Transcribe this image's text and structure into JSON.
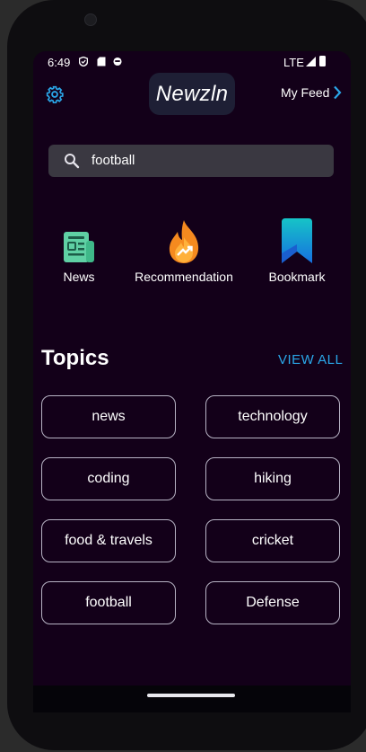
{
  "status_bar": {
    "time": "6:49",
    "network": "LTE"
  },
  "header": {
    "logo": "Newzln",
    "my_feed": "My Feed"
  },
  "search": {
    "value": "football",
    "placeholder": ""
  },
  "quick_actions": [
    {
      "label": "News",
      "icon": "newspaper-icon"
    },
    {
      "label": "Recommendation",
      "icon": "fire-trending-icon"
    },
    {
      "label": "Bookmark",
      "icon": "bookmark-icon"
    }
  ],
  "topics": {
    "title": "Topics",
    "view_all": "VIEW ALL",
    "items": [
      "news",
      "technology",
      "coding",
      "hiking",
      "food & travels",
      "cricket",
      "football",
      "Defense"
    ]
  },
  "colors": {
    "screen_bg": "#130019",
    "accent": "#2aa6e8",
    "chip_border": "#b7b3c4",
    "search_bg": "#3a3841"
  }
}
